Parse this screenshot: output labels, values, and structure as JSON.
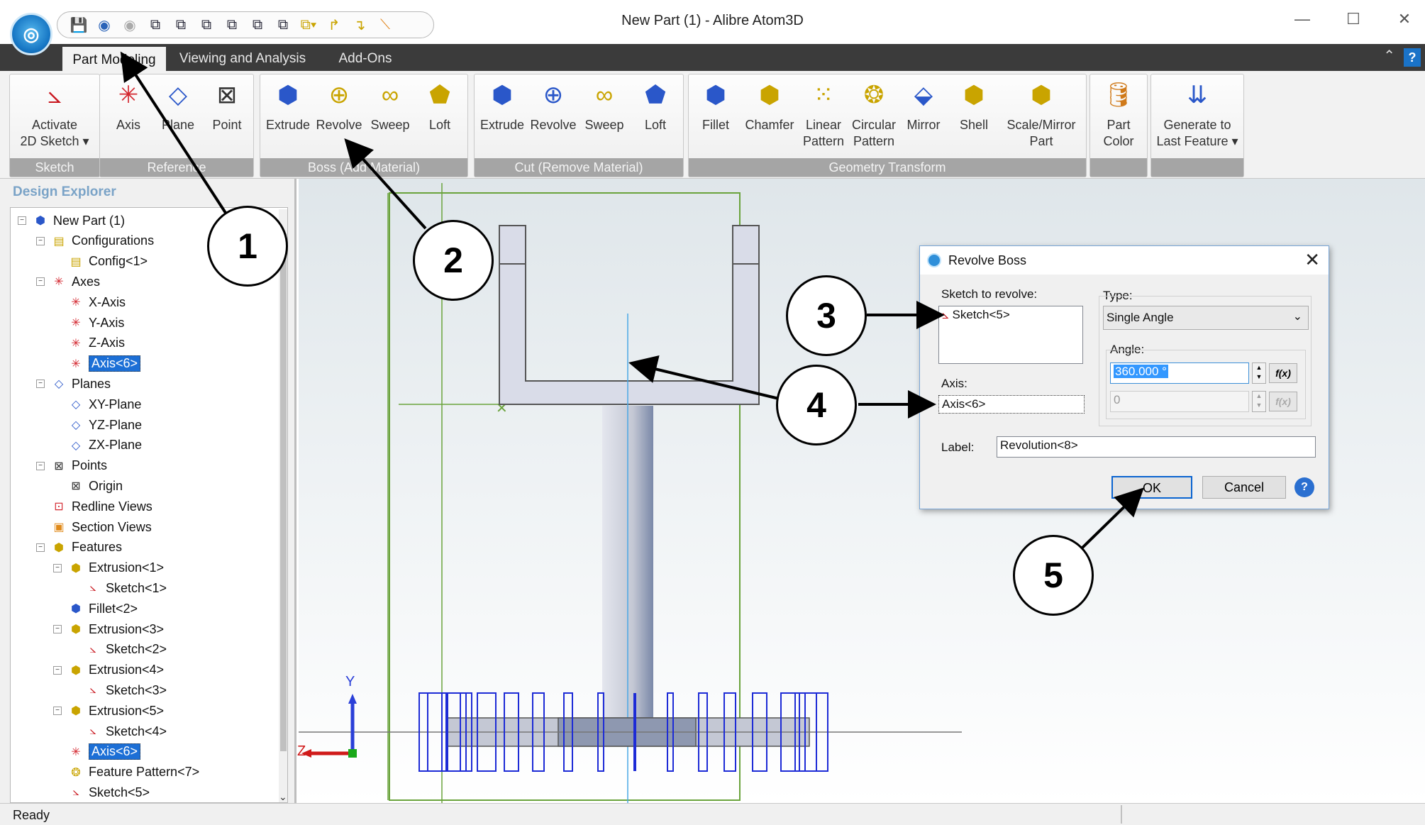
{
  "window": {
    "title": "New Part (1) - Alibre Atom3D",
    "minimize": "—",
    "maximize": "☐",
    "close": "✕"
  },
  "quick_access": {
    "icons": [
      "save-icon",
      "undo-icon",
      "redo-icon",
      "iso-view-icon",
      "front-view-icon",
      "top-view-icon",
      "right-view-icon",
      "back-view-icon",
      "view-orient-icon",
      "sketch-arrow-icon",
      "sketch-return-icon",
      "line-icon"
    ]
  },
  "tabs": [
    "Part Modeling",
    "Viewing and Analysis",
    "Add-Ons"
  ],
  "ribbon": {
    "groups": [
      {
        "label": "Sketch",
        "buttons": [
          {
            "label": "Activate\n2D Sketch ▾",
            "icon": "sketch-icon"
          }
        ]
      },
      {
        "label": "Reference",
        "buttons": [
          {
            "label": "Axis",
            "icon": "axis-icon"
          },
          {
            "label": "Plane",
            "icon": "plane-icon"
          },
          {
            "label": "Point",
            "icon": "point-icon"
          }
        ]
      },
      {
        "label": "Boss (Add Material)",
        "buttons": [
          {
            "label": "Extrude",
            "icon": "extrude-icon"
          },
          {
            "label": "Revolve",
            "icon": "revolve-icon"
          },
          {
            "label": "Sweep",
            "icon": "sweep-icon"
          },
          {
            "label": "Loft",
            "icon": "loft-icon"
          }
        ]
      },
      {
        "label": "Cut (Remove Material)",
        "buttons": [
          {
            "label": "Extrude",
            "icon": "extrude-cut-icon"
          },
          {
            "label": "Revolve",
            "icon": "revolve-cut-icon"
          },
          {
            "label": "Sweep",
            "icon": "sweep-cut-icon"
          },
          {
            "label": "Loft",
            "icon": "loft-cut-icon"
          }
        ]
      },
      {
        "label": "Geometry Transform",
        "buttons": [
          {
            "label": "Fillet",
            "icon": "fillet-icon"
          },
          {
            "label": "Chamfer",
            "icon": "chamfer-icon"
          },
          {
            "label": "Linear\nPattern",
            "icon": "linear-pattern-icon"
          },
          {
            "label": "Circular\nPattern",
            "icon": "circular-pattern-icon"
          },
          {
            "label": "Mirror",
            "icon": "mirror-icon"
          },
          {
            "label": "Shell",
            "icon": "shell-icon"
          },
          {
            "label": "Scale/Mirror\nPart",
            "icon": "scale-mirror-icon"
          }
        ]
      },
      {
        "label": "",
        "buttons": [
          {
            "label": "Part\nColor",
            "icon": "part-color-icon"
          }
        ]
      },
      {
        "label": "",
        "buttons": [
          {
            "label": "Generate to\nLast Feature ▾",
            "icon": "generate-icon"
          }
        ]
      }
    ]
  },
  "explorer": {
    "title": "Design Explorer",
    "nodes": [
      {
        "label": "New Part (1)",
        "icon": "part-icon"
      },
      {
        "label": "Configurations",
        "icon": "configurations-icon"
      },
      {
        "label": "Config<1>",
        "icon": "config-icon"
      },
      {
        "label": "Axes",
        "icon": "axes-icon"
      },
      {
        "label": "X-Axis",
        "icon": "axis-icon"
      },
      {
        "label": "Y-Axis",
        "icon": "axis-icon"
      },
      {
        "label": "Z-Axis",
        "icon": "axis-icon"
      },
      {
        "label": "Axis<6>",
        "icon": "axis-icon",
        "selected": true
      },
      {
        "label": "Planes",
        "icon": "planes-icon"
      },
      {
        "label": "XY-Plane",
        "icon": "plane-icon"
      },
      {
        "label": "YZ-Plane",
        "icon": "plane-icon"
      },
      {
        "label": "ZX-Plane",
        "icon": "plane-icon"
      },
      {
        "label": "Points",
        "icon": "points-icon"
      },
      {
        "label": "Origin",
        "icon": "point-icon"
      },
      {
        "label": "Redline Views",
        "icon": "redline-icon"
      },
      {
        "label": "Section Views",
        "icon": "section-icon"
      },
      {
        "label": "Features",
        "icon": "features-icon"
      },
      {
        "label": "Extrusion<1>",
        "icon": "extrusion-icon"
      },
      {
        "label": "Sketch<1>",
        "icon": "sketch-icon"
      },
      {
        "label": "Fillet<2>",
        "icon": "fillet-icon"
      },
      {
        "label": "Extrusion<3>",
        "icon": "extrusion-icon"
      },
      {
        "label": "Sketch<2>",
        "icon": "sketch-icon"
      },
      {
        "label": "Extrusion<4>",
        "icon": "extrusion-icon"
      },
      {
        "label": "Sketch<3>",
        "icon": "sketch-icon"
      },
      {
        "label": "Extrusion<5>",
        "icon": "extrusion-icon"
      },
      {
        "label": "Sketch<4>",
        "icon": "sketch-icon"
      },
      {
        "label": "Axis<6>",
        "icon": "axis-icon",
        "selected": true
      },
      {
        "label": "Feature Pattern<7>",
        "icon": "pattern-icon"
      },
      {
        "label": "Sketch<5>",
        "icon": "sketch-icon"
      }
    ]
  },
  "dialog": {
    "title": "Revolve Boss",
    "sketch_label": "Sketch to revolve:",
    "sketch_value": "Sketch<5>",
    "axis_label": "Axis:",
    "axis_value": "Axis<6>",
    "type_label": "Type:",
    "type_value": "Single Angle",
    "angle_label": "Angle:",
    "angle_value": "360.000 °",
    "angle2_value": "0",
    "fx": "f(x)",
    "label_label": "Label:",
    "label_value": "Revolution<8>",
    "ok": "OK",
    "cancel": "Cancel",
    "help": "?"
  },
  "viewport": {
    "triad": {
      "y": "Y",
      "z": "Z"
    }
  },
  "status": "Ready",
  "callouts": [
    "1",
    "2",
    "3",
    "4",
    "5"
  ]
}
